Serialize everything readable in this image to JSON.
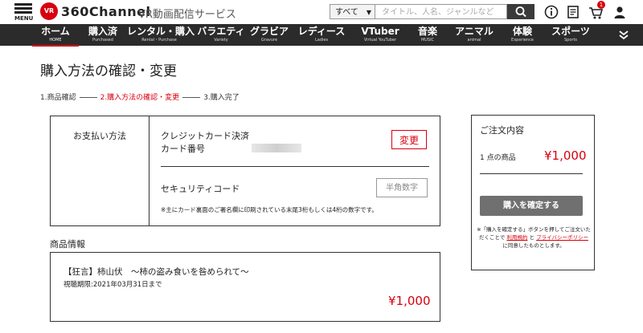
{
  "header": {
    "menu_label": "MENU",
    "logo_mark": "VR",
    "logo_text": "360Channel",
    "tagline": "VR動画配信サービス",
    "search_category": "すべて",
    "search_placeholder": "タイトル、人名、ジャンルなど",
    "cart_count": "1"
  },
  "nav": {
    "items": [
      {
        "jp": "ホーム",
        "en": "HOME"
      },
      {
        "jp": "購入済",
        "en": "Purchased"
      },
      {
        "jp": "レンタル・購入",
        "en": "Rental・Purchase"
      },
      {
        "jp": "バラエティ",
        "en": "Variety"
      },
      {
        "jp": "グラビア",
        "en": "Gravure"
      },
      {
        "jp": "レディース",
        "en": "Ladies"
      },
      {
        "jp": "VTuber",
        "en": "Virtual YouTuber"
      },
      {
        "jp": "音楽",
        "en": "MUSIC"
      },
      {
        "jp": "アニマル",
        "en": "animal"
      },
      {
        "jp": "体験",
        "en": "Experience"
      },
      {
        "jp": "スポーツ",
        "en": "Sports"
      }
    ]
  },
  "page": {
    "title": "購入方法の確認・変更",
    "steps": [
      "1.商品確認",
      "2.購入方法の確認・変更",
      "3.購入完了"
    ]
  },
  "payment": {
    "label": "お支払い方法",
    "method": "クレジットカード決済",
    "card_number_label": "カード番号",
    "change_button": "変更",
    "security_label": "セキュリティコード",
    "security_placeholder": "半角数字",
    "security_note": "※主にカード裏面のご署名欄に印刷されている末尾3桁もしくは4桁の数字です。"
  },
  "product": {
    "heading": "商品情報",
    "title": "【狂言】柿山伏　～柿の盗み食いを咎められて～",
    "period": "視聴期限:2021年03月31日まで",
    "price": "¥1,000"
  },
  "order": {
    "heading": "ご注文内容",
    "items_label": "1 点の商品",
    "price": "¥1,000",
    "confirm_button": "購入を確定する",
    "note_1": "※「購入を確定する」ボタンを押してご注文いただくことで",
    "terms_link": "利用規約",
    "note_and": "と",
    "privacy_link": "プライバシーポリシー",
    "note_2": "に同意したものとします。"
  },
  "colors": {
    "accent": "#d7000f",
    "nav_bg": "#2b2b2b",
    "button_gray": "#707070"
  }
}
